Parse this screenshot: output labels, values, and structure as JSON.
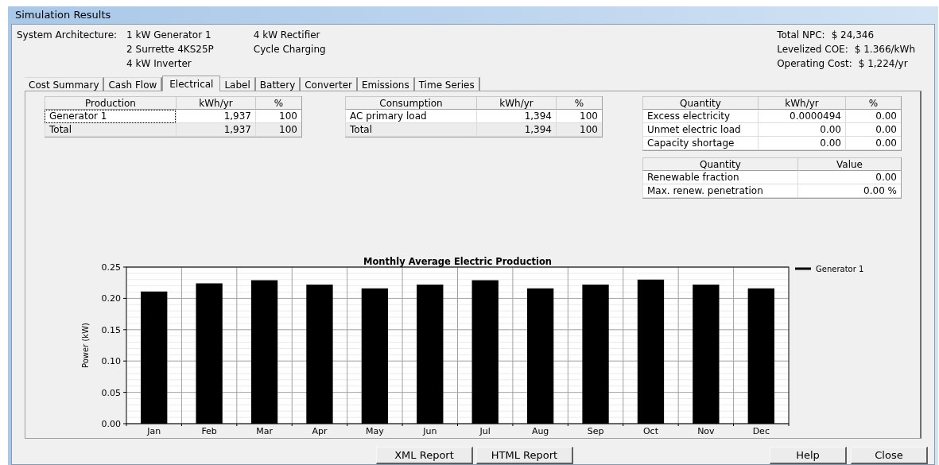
{
  "window": {
    "title": "Simulation Results"
  },
  "architecture": {
    "label": "System Architecture:",
    "components": [
      "1 kW Generator 1",
      "2 Surrette 4KS25P",
      "4 kW Inverter",
      "4 kW Rectifier",
      "Cycle Charging"
    ]
  },
  "summary": [
    {
      "label": "Total NPC:",
      "value": "$ 24,346"
    },
    {
      "label": "Levelized COE:",
      "value": "$ 1.366/kWh"
    },
    {
      "label": "Operating Cost:",
      "value": "$ 1,224/yr"
    }
  ],
  "tabs": [
    {
      "label": "Cost Summary",
      "selected": false
    },
    {
      "label": "Cash Flow",
      "selected": false
    },
    {
      "label": "Electrical",
      "selected": true
    },
    {
      "label": "Label",
      "selected": false
    },
    {
      "label": "Battery",
      "selected": false
    },
    {
      "label": "Converter",
      "selected": false
    },
    {
      "label": "Emissions",
      "selected": false
    },
    {
      "label": "Time Series",
      "selected": false
    }
  ],
  "tables": [
    {
      "columns": [
        "Production",
        "kWh/yr",
        "%"
      ],
      "rows": [
        {
          "cells": [
            "Generator 1",
            "1,937",
            "100"
          ],
          "total": false,
          "focused": true
        },
        {
          "cells": [
            "Total",
            "1,937",
            "100"
          ],
          "total": true,
          "focused": false
        }
      ]
    },
    {
      "columns": [
        "Consumption",
        "kWh/yr",
        "%"
      ],
      "rows": [
        {
          "cells": [
            "AC primary load",
            "1,394",
            "100"
          ],
          "total": false,
          "focused": false
        },
        {
          "cells": [
            "Total",
            "1,394",
            "100"
          ],
          "total": true,
          "focused": false
        }
      ]
    },
    {
      "columns": [
        "Quantity",
        "kWh/yr",
        "%"
      ],
      "rows": [
        {
          "cells": [
            "Excess electricity",
            "0.0000494",
            "0.00"
          ],
          "total": false,
          "focused": false
        },
        {
          "cells": [
            "Unmet electric load",
            "0.00",
            "0.00"
          ],
          "total": false,
          "focused": false
        },
        {
          "cells": [
            "Capacity shortage",
            "0.00",
            "0.00"
          ],
          "total": false,
          "focused": false
        }
      ]
    },
    {
      "columns": [
        "Quantity",
        "Value"
      ],
      "rows": [
        {
          "cells": [
            "Renewable fraction",
            "0.00"
          ],
          "total": false,
          "focused": false
        },
        {
          "cells": [
            "Max. renew. penetration",
            "0.00 %"
          ],
          "total": false,
          "focused": false
        }
      ]
    }
  ],
  "chart_data": {
    "type": "bar",
    "title": "Monthly Average Electric Production",
    "ylabel": "Power (kW)",
    "categories": [
      "Jan",
      "Feb",
      "Mar",
      "Apr",
      "May",
      "Jun",
      "Jul",
      "Aug",
      "Sep",
      "Oct",
      "Nov",
      "Dec"
    ],
    "series": [
      {
        "name": "Generator 1",
        "color": "#000000",
        "values": [
          0.211,
          0.224,
          0.229,
          0.222,
          0.216,
          0.222,
          0.229,
          0.216,
          0.222,
          0.23,
          0.222,
          0.216
        ]
      }
    ],
    "ylim": [
      0,
      0.25
    ],
    "grid": true,
    "yticks": [
      {
        "value": 0,
        "label": "0.00"
      },
      {
        "value": 0.05,
        "label": "0.05"
      },
      {
        "value": 0.1,
        "label": "0.10"
      },
      {
        "value": 0.15,
        "label": "0.15"
      },
      {
        "value": 0.2,
        "label": "0.20"
      },
      {
        "value": 0.25,
        "label": "0.25"
      }
    ]
  },
  "buttons": [
    "XML Report",
    "HTML Report",
    "Help",
    "Close"
  ]
}
